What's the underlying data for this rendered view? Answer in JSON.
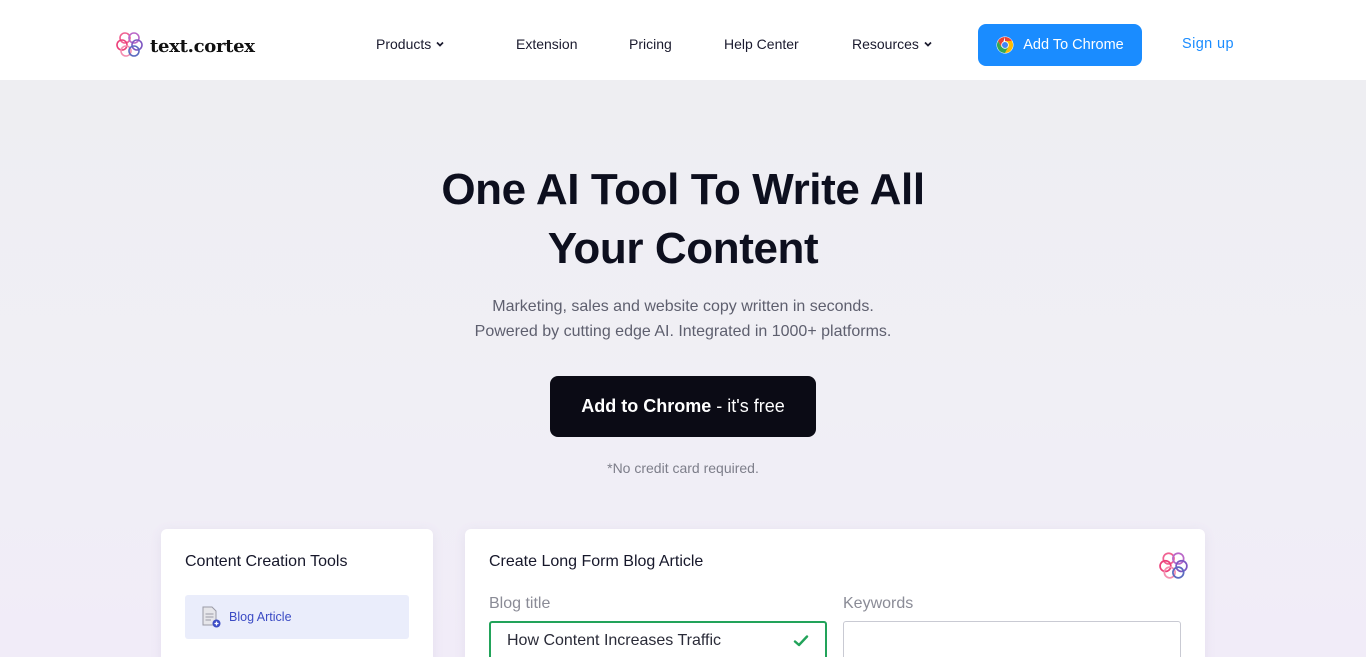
{
  "header": {
    "logo_text": "text.cortex",
    "nav": [
      {
        "label": "Products",
        "dropdown": true
      },
      {
        "label": "Extension",
        "dropdown": false
      },
      {
        "label": "Pricing",
        "dropdown": false
      },
      {
        "label": "Help Center",
        "dropdown": false
      },
      {
        "label": "Resources",
        "dropdown": true
      }
    ],
    "add_to_chrome_label": "Add To Chrome",
    "signup_label": "Sign up"
  },
  "hero": {
    "title_line1": "One AI Tool To Write All",
    "title_line2": "Your Content",
    "subtitle_line1": "Marketing, sales and website copy written in seconds.",
    "subtitle_line2": "Powered by cutting edge AI. Integrated in 1000+ platforms.",
    "cta_bold": "Add to Chrome",
    "cta_rest": " - it's free",
    "note": "*No credit card required."
  },
  "tools_card": {
    "title": "Content Creation Tools",
    "active_item": "Blog Article"
  },
  "blog_card": {
    "title": "Create Long Form Blog Article",
    "blog_title_label": "Blog title",
    "blog_title_value": "How Content Increases Traffic",
    "keywords_label": "Keywords",
    "keywords_value": ""
  },
  "colors": {
    "accent_blue": "#1a8cff",
    "cta_dark": "#0b0b15",
    "success_green": "#22a35a",
    "tool_item_bg": "#eaedfb",
    "tool_item_text": "#3b4bc4"
  },
  "icons": {
    "logo": "brain-logo-icon",
    "chevron": "chevron-down-icon",
    "chrome": "chrome-icon",
    "document": "document-add-icon",
    "check": "checkmark-icon"
  }
}
